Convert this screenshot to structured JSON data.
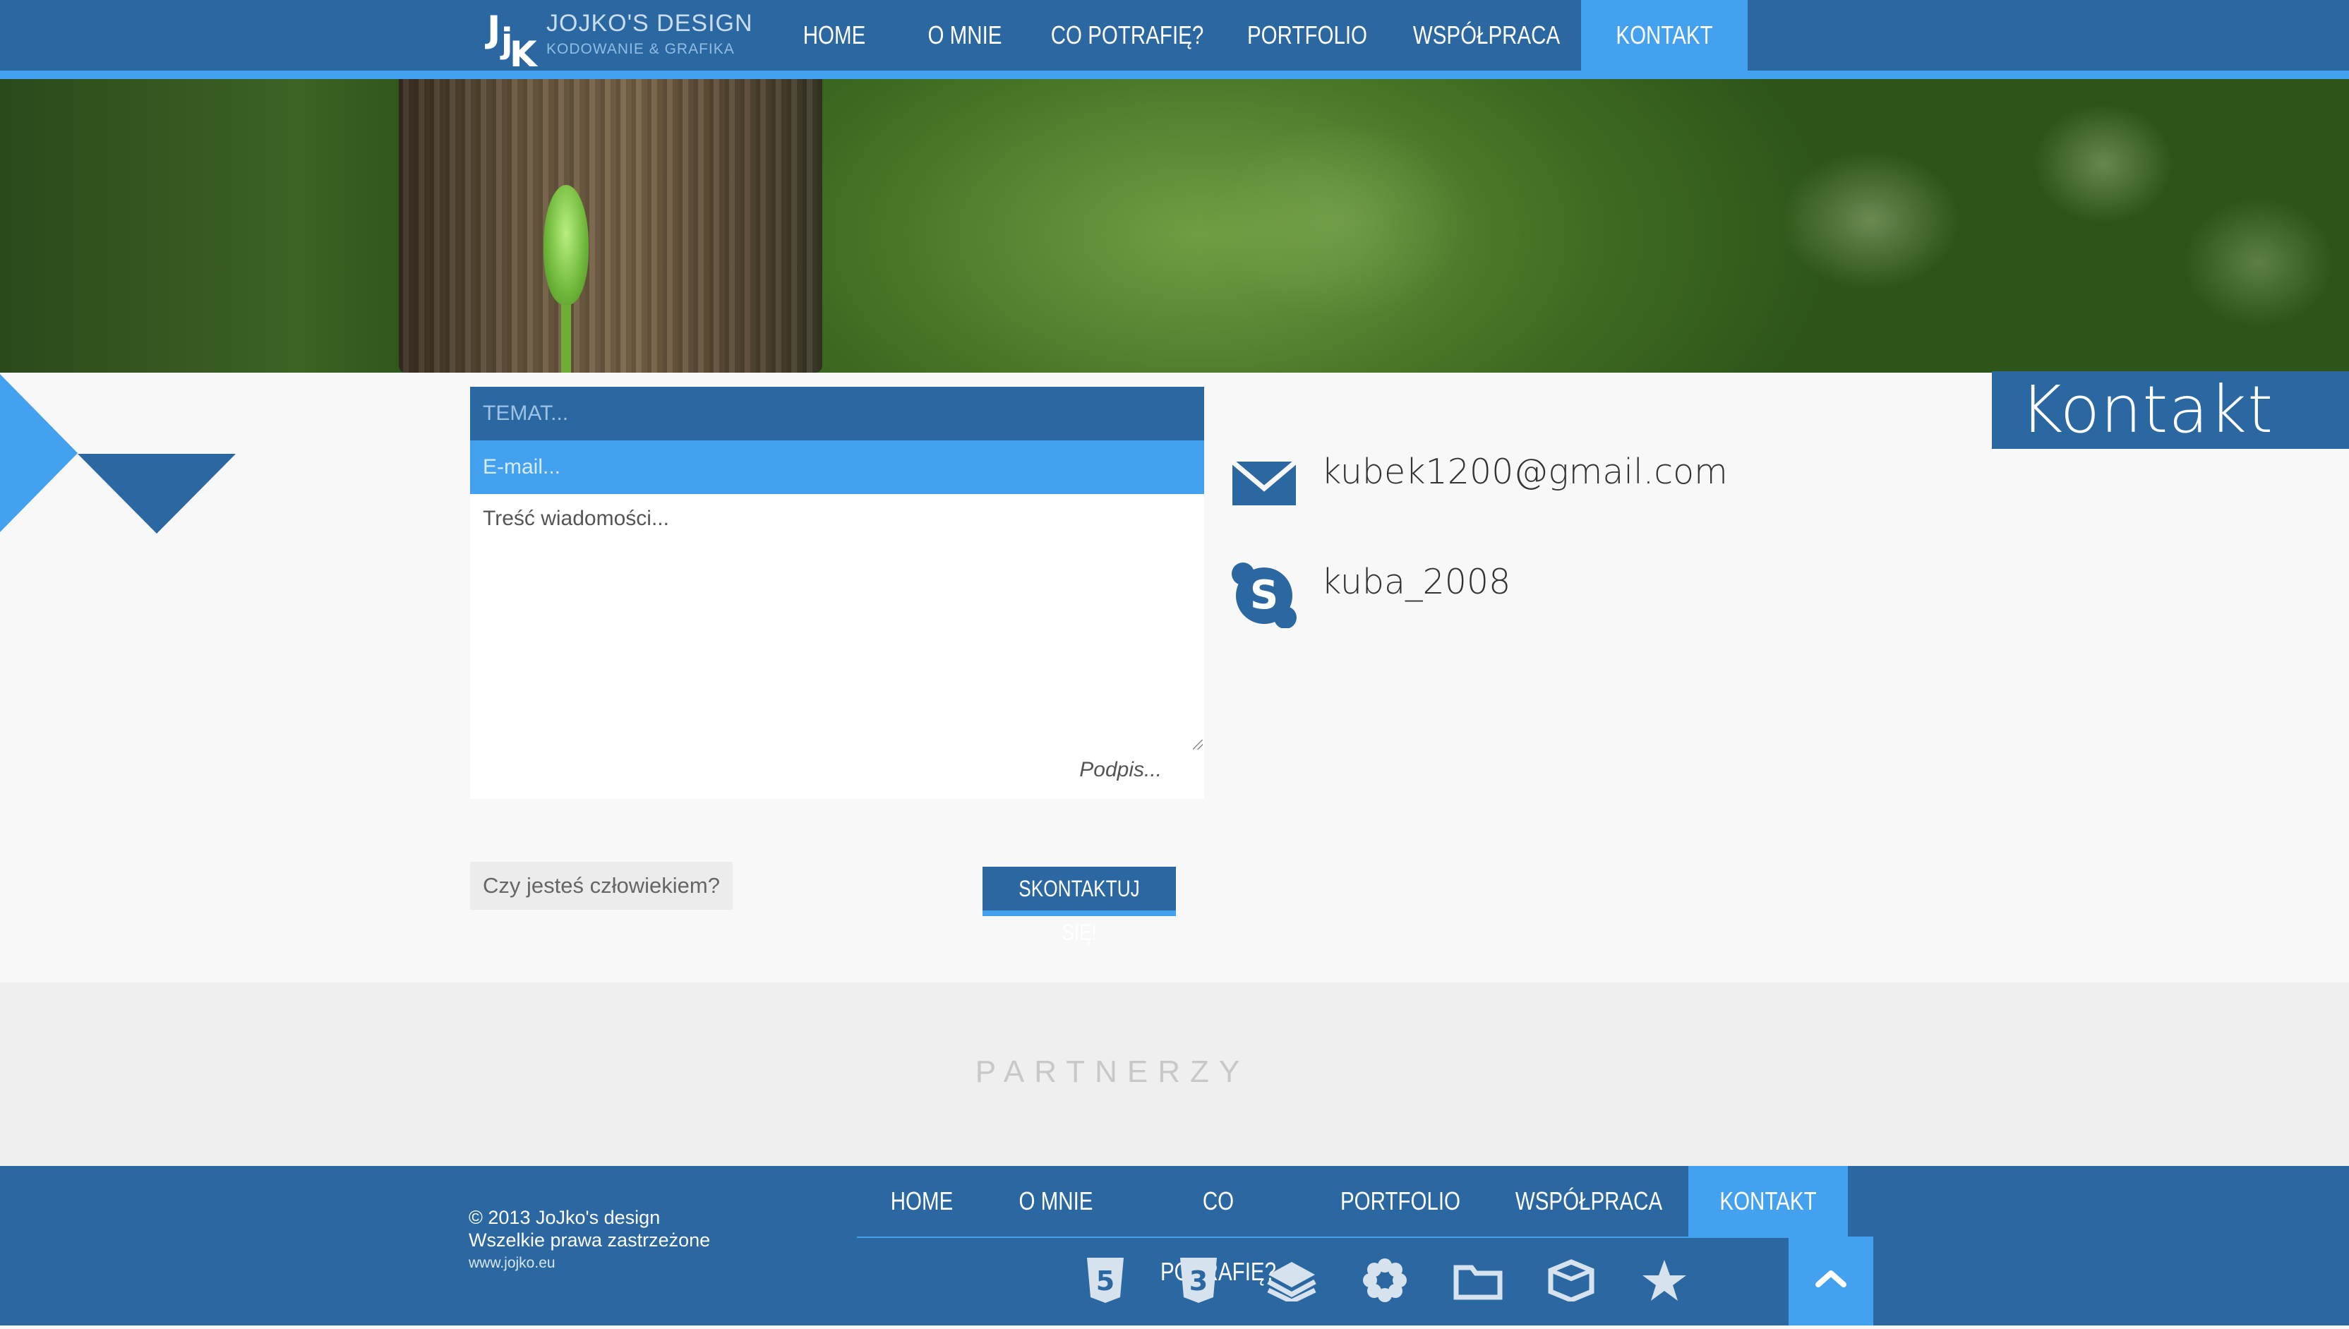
{
  "header": {
    "logo_mark": "JjK",
    "logo_title": "JOJKO'S DESIGN",
    "logo_subtitle": "KODOWANIE & GRAFIKA",
    "nav": [
      {
        "label": "HOME",
        "active": false
      },
      {
        "label": "O MNIE",
        "active": false
      },
      {
        "label": "CO POTRAFIĘ?",
        "active": false
      },
      {
        "label": "PORTFOLIO",
        "active": false
      },
      {
        "label": "WSPÓŁPRACA",
        "active": false
      },
      {
        "label": "KONTAKT",
        "active": true
      }
    ]
  },
  "page": {
    "title": "Kontakt"
  },
  "form": {
    "subject_placeholder": "TEMAT...",
    "email_placeholder": "E-mail...",
    "message_placeholder": "Treść wiadomości...",
    "signature_placeholder": "Podpis...",
    "captcha_placeholder": "Czy jesteś człowiekiem?",
    "submit_label": "SKONTAKTUJ SIĘ!"
  },
  "contact": {
    "email": "kubek1200@gmail.com",
    "skype": "kuba_2008",
    "email_icon": "envelope-icon",
    "skype_icon": "skype-icon"
  },
  "partners": {
    "heading": "PARTNERZY"
  },
  "footer": {
    "copyright": "© 2013 JoJko's design",
    "rights": "Wszelkie prawa zastrzeżone",
    "site": "www.jojko.eu",
    "nav": [
      {
        "label": "HOME",
        "active": false
      },
      {
        "label": "O MNIE",
        "active": false
      },
      {
        "label": "CO POTRAFIĘ?",
        "active": false
      },
      {
        "label": "PORTFOLIO",
        "active": false
      },
      {
        "label": "WSPÓŁPRACA",
        "active": false
      },
      {
        "label": "KONTAKT",
        "active": true
      }
    ],
    "badges": [
      "html5-icon",
      "css3-icon",
      "layers-icon",
      "gear-flower-icon",
      "responsive-icon",
      "box-icon",
      "star-icon"
    ],
    "to_top_icon": "chevron-up-icon"
  },
  "colors": {
    "primary": "#2b67a0",
    "accent": "#43a1f0",
    "page_bg": "#f8f8f8",
    "partners_bg": "#efefef"
  }
}
